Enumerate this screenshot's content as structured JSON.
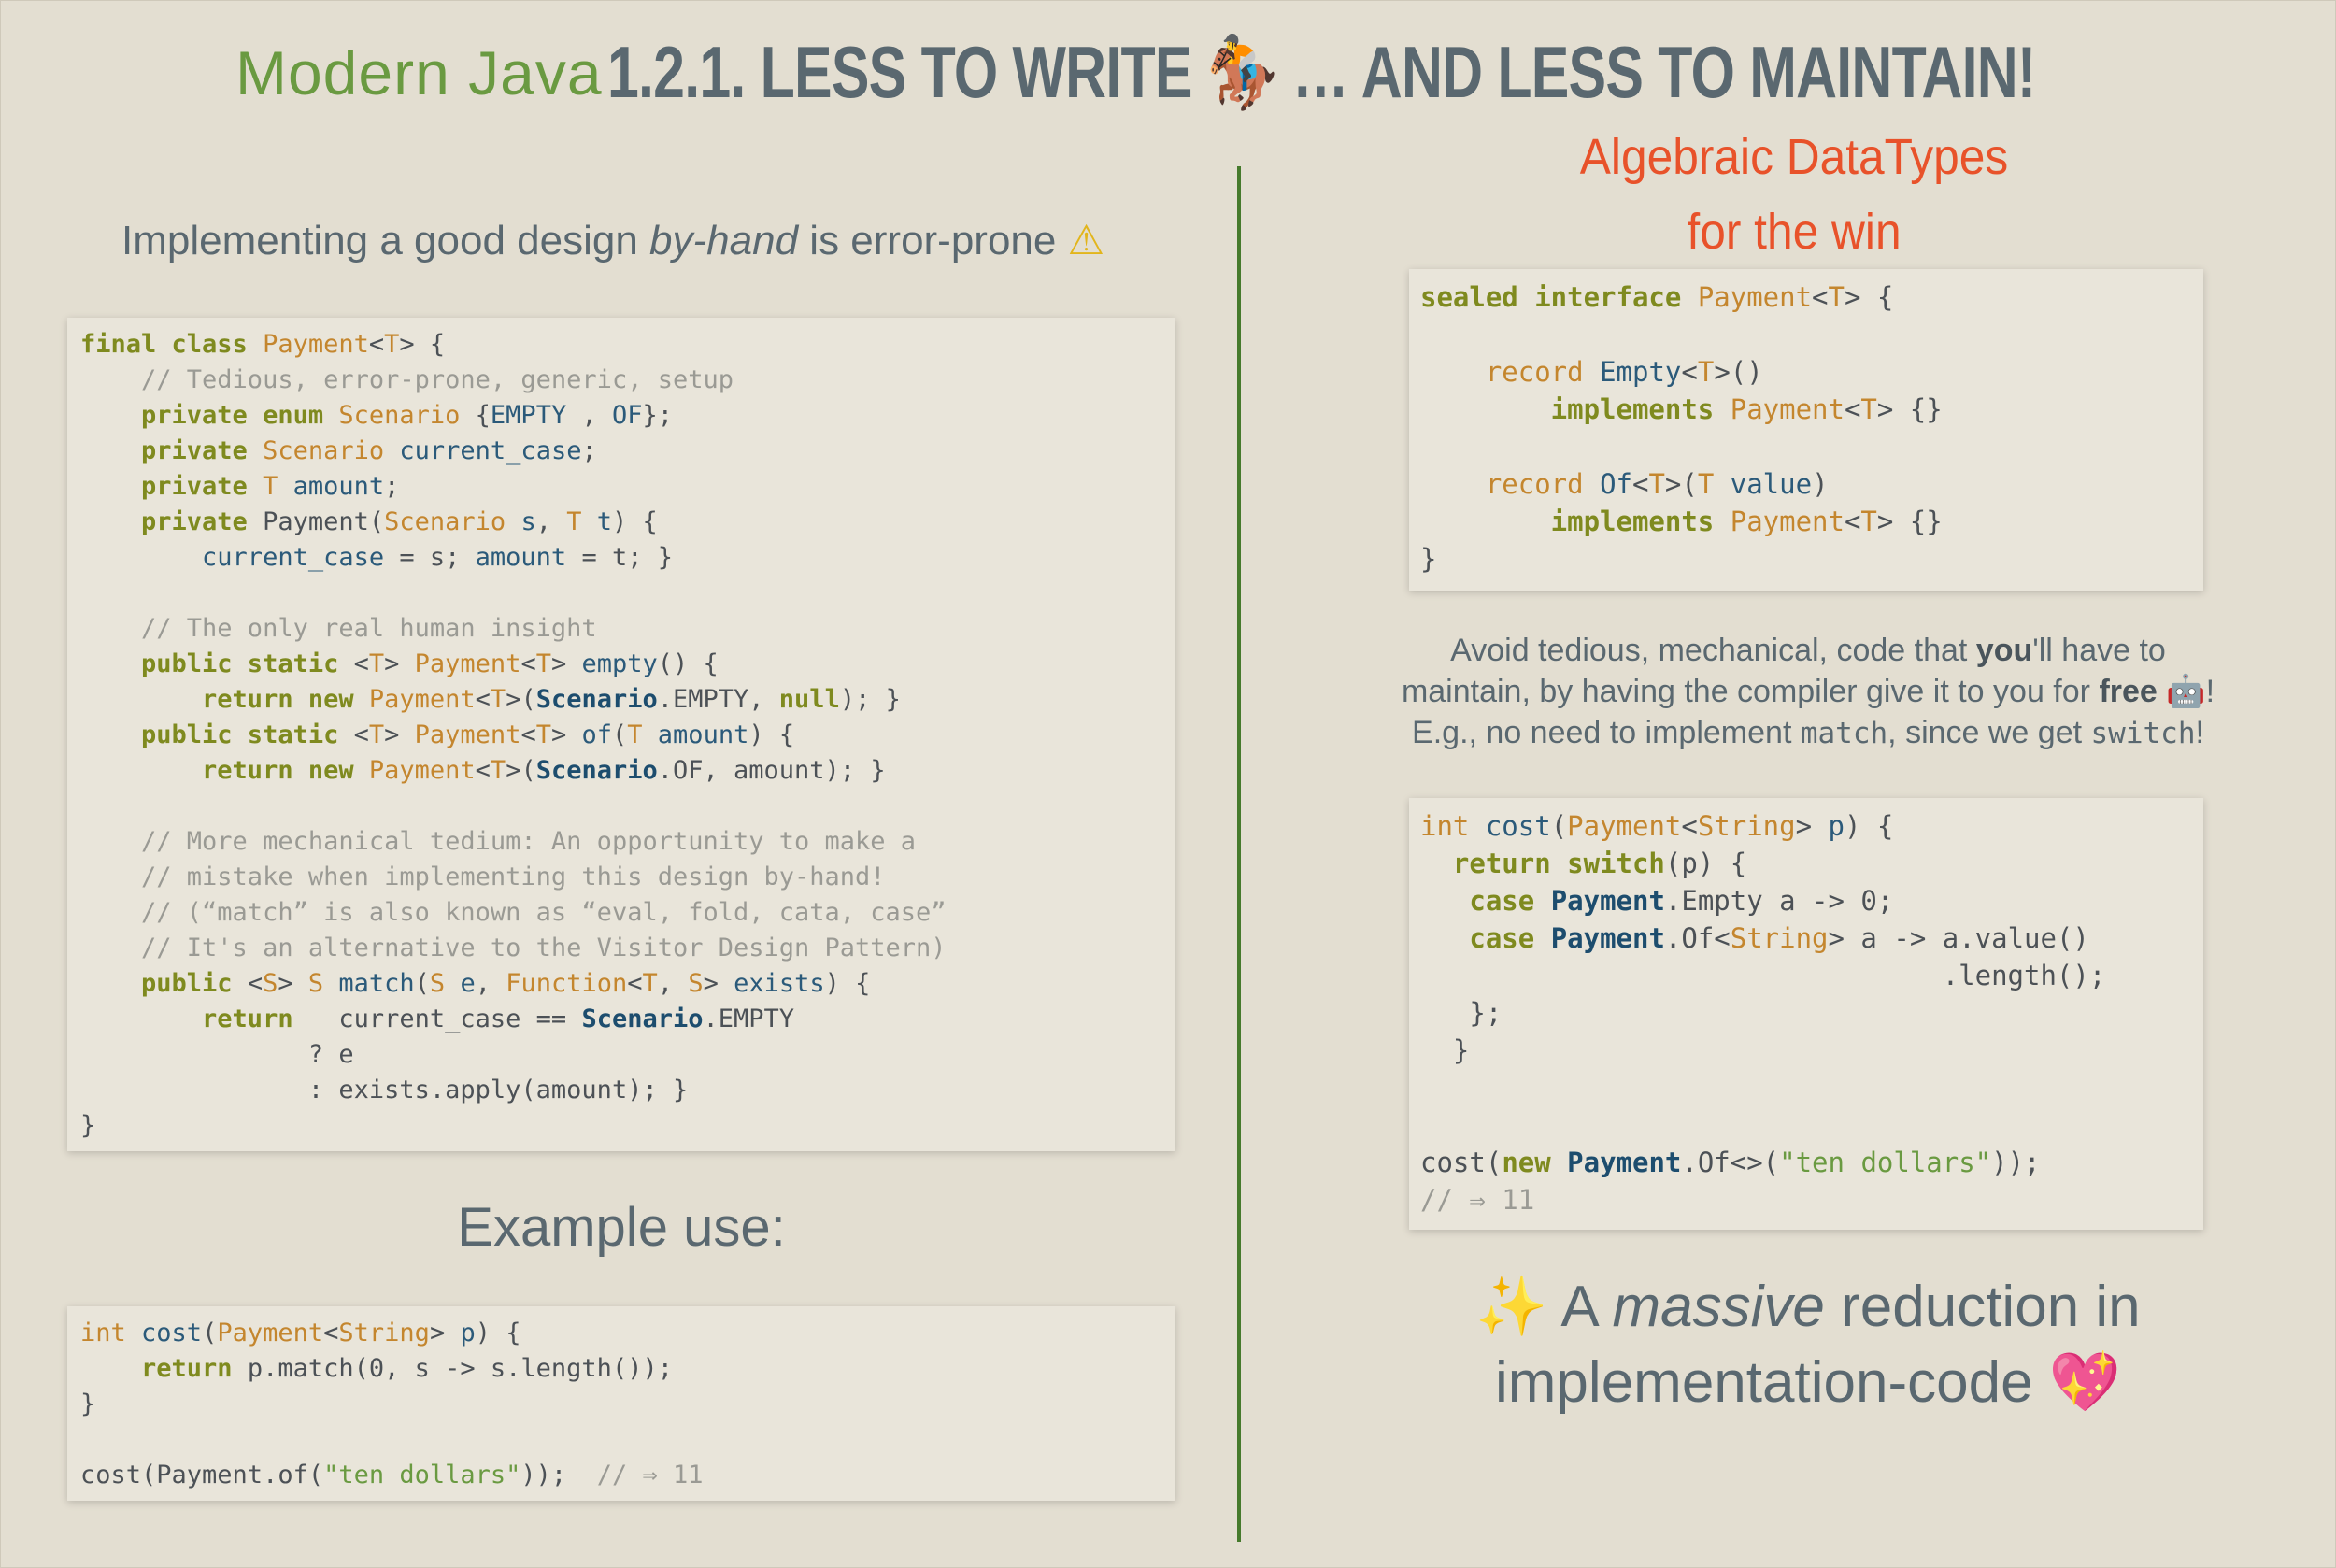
{
  "header": {
    "brand": "Modern Java",
    "title_text": "1.2.1. LESS TO WRITE",
    "title_emoji": "🏇",
    "title_tail": " … AND LESS TO MAINTAIN!",
    "adt_line1": "Algebraic DataTypes",
    "adt_line2": "for the win"
  },
  "left": {
    "lead_pre": "Implementing a good design ",
    "lead_em": "by-hand",
    "lead_post": " is error-prone ",
    "lead_icon": "⚠",
    "example_heading": "Example use:"
  },
  "right": {
    "avoid_1": "Avoid tedious, mechanical, code that ",
    "avoid_you": "you",
    "avoid_2": "'ll have to",
    "avoid_3": "maintain, by having the compiler give it to you for ",
    "avoid_free": "free",
    "avoid_robot": "🤖",
    "avoid_bang": "!",
    "avoid_4": "E.g., no need to implement ",
    "avoid_match": "match",
    "avoid_5": ", since we get ",
    "avoid_switch": "switch",
    "avoid_6": "!",
    "red_spark": "✨",
    "red_1": " A ",
    "red_em": "massive",
    "red_2": " reduction in",
    "red_3": "implementation-code ",
    "red_heart": "💖"
  },
  "code1": [
    [
      [
        "k",
        "final class "
      ],
      [
        "t",
        "Payment"
      ],
      [
        "",
        "<"
      ],
      [
        "t",
        "T"
      ],
      [
        "",
        "> {"
      ]
    ],
    [
      [
        "c",
        "    // Tedious, error-prone, generic, setup"
      ]
    ],
    [
      [
        "k",
        "    private enum "
      ],
      [
        "t",
        "Scenario "
      ],
      [
        "",
        "{"
      ],
      [
        "f",
        "EMPTY"
      ],
      [
        "",
        " , "
      ],
      [
        "f",
        "OF"
      ],
      [
        "",
        "};"
      ]
    ],
    [
      [
        "k",
        "    private "
      ],
      [
        "t",
        "Scenario "
      ],
      [
        "f",
        "current_case"
      ],
      [
        "",
        ";"
      ]
    ],
    [
      [
        "k",
        "    private "
      ],
      [
        "t",
        "T "
      ],
      [
        "f",
        "amount"
      ],
      [
        "",
        ";"
      ]
    ],
    [
      [
        "k",
        "    private "
      ],
      [
        "",
        "Payment("
      ],
      [
        "t",
        "Scenario "
      ],
      [
        "f",
        "s"
      ],
      [
        "",
        ", "
      ],
      [
        "t",
        "T "
      ],
      [
        "f",
        "t"
      ],
      [
        "",
        ") {"
      ]
    ],
    [
      [
        "f",
        "        current_case"
      ],
      [
        "",
        " = s; "
      ],
      [
        "f",
        "amount"
      ],
      [
        "",
        " = t; }"
      ]
    ],
    [
      [
        "",
        ""
      ]
    ],
    [
      [
        "c",
        "    // The only real human insight"
      ]
    ],
    [
      [
        "k",
        "    public static "
      ],
      [
        "",
        "<"
      ],
      [
        "t",
        "T"
      ],
      [
        "",
        "> "
      ],
      [
        "t",
        "Payment"
      ],
      [
        "",
        "<"
      ],
      [
        "t",
        "T"
      ],
      [
        "",
        "> "
      ],
      [
        "f",
        "empty"
      ],
      [
        "",
        "() {"
      ]
    ],
    [
      [
        "k",
        "        return new "
      ],
      [
        "t",
        "Payment"
      ],
      [
        "",
        "<"
      ],
      [
        "t",
        "T"
      ],
      [
        "",
        ">("
      ],
      [
        "b",
        "Scenario"
      ],
      [
        "",
        ".EMPTY, "
      ],
      [
        "k",
        "null"
      ],
      [
        "",
        "); }"
      ]
    ],
    [
      [
        "k",
        "    public static "
      ],
      [
        "",
        "<"
      ],
      [
        "t",
        "T"
      ],
      [
        "",
        "> "
      ],
      [
        "t",
        "Payment"
      ],
      [
        "",
        "<"
      ],
      [
        "t",
        "T"
      ],
      [
        "",
        "> "
      ],
      [
        "f",
        "of"
      ],
      [
        "",
        "("
      ],
      [
        "t",
        "T "
      ],
      [
        "f",
        "amount"
      ],
      [
        "",
        ") {"
      ]
    ],
    [
      [
        "k",
        "        return new "
      ],
      [
        "t",
        "Payment"
      ],
      [
        "",
        "<"
      ],
      [
        "t",
        "T"
      ],
      [
        "",
        ">("
      ],
      [
        "b",
        "Scenario"
      ],
      [
        "",
        ".OF, amount); }"
      ]
    ],
    [
      [
        "",
        ""
      ]
    ],
    [
      [
        "c",
        "    // More mechanical tedium: An opportunity to make a"
      ]
    ],
    [
      [
        "c",
        "    // mistake when implementing this design by-hand!"
      ]
    ],
    [
      [
        "c",
        "    // (“match” is also known as “eval, fold, cata, case”"
      ]
    ],
    [
      [
        "c",
        "    // It's an alternative to the Visitor Design Pattern)"
      ]
    ],
    [
      [
        "k",
        "    public "
      ],
      [
        "",
        "<"
      ],
      [
        "t",
        "S"
      ],
      [
        "",
        "> "
      ],
      [
        "t",
        "S "
      ],
      [
        "f",
        "match"
      ],
      [
        "",
        "("
      ],
      [
        "t",
        "S "
      ],
      [
        "f",
        "e"
      ],
      [
        "",
        ", "
      ],
      [
        "t",
        "Function"
      ],
      [
        "",
        "<"
      ],
      [
        "t",
        "T"
      ],
      [
        "",
        ", "
      ],
      [
        "t",
        "S"
      ],
      [
        "",
        "> "
      ],
      [
        "f",
        "exists"
      ],
      [
        "",
        ") {"
      ]
    ],
    [
      [
        "k",
        "        return   "
      ],
      [
        "",
        "current_case == "
      ],
      [
        "b",
        "Scenario"
      ],
      [
        "",
        ".EMPTY"
      ]
    ],
    [
      [
        "",
        "               ? e"
      ]
    ],
    [
      [
        "",
        "               : exists.apply(amount); }"
      ]
    ],
    [
      [
        "",
        "}"
      ]
    ]
  ],
  "code2": [
    [
      [
        "t",
        "int "
      ],
      [
        "f",
        "cost"
      ],
      [
        "",
        "("
      ],
      [
        "t",
        "Payment"
      ],
      [
        "",
        "<"
      ],
      [
        "t",
        "String"
      ],
      [
        "",
        "> "
      ],
      [
        "f",
        "p"
      ],
      [
        "",
        ") {"
      ]
    ],
    [
      [
        "k",
        "    return "
      ],
      [
        "",
        "p.match(0, s -> s.length());"
      ]
    ],
    [
      [
        "",
        "}"
      ]
    ],
    [
      [
        "",
        ""
      ]
    ],
    [
      [
        "",
        "cost(Payment.of("
      ],
      [
        "s",
        "\"ten dollars\""
      ],
      [
        "",
        "));  "
      ],
      [
        "c",
        "// ⇒ 11"
      ]
    ]
  ],
  "code3": [
    [
      [
        "k",
        "sealed interface "
      ],
      [
        "t",
        "Payment"
      ],
      [
        "",
        "<"
      ],
      [
        "t",
        "T"
      ],
      [
        "",
        "> {"
      ]
    ],
    [
      [
        "",
        ""
      ]
    ],
    [
      [
        "t",
        "    record "
      ],
      [
        "f",
        "Empty"
      ],
      [
        "",
        "<"
      ],
      [
        "t",
        "T"
      ],
      [
        "",
        ">()"
      ]
    ],
    [
      [
        "k",
        "        implements "
      ],
      [
        "t",
        "Payment"
      ],
      [
        "",
        "<"
      ],
      [
        "t",
        "T"
      ],
      [
        "",
        "> {}"
      ]
    ],
    [
      [
        "",
        ""
      ]
    ],
    [
      [
        "t",
        "    record "
      ],
      [
        "f",
        "Of"
      ],
      [
        "",
        "<"
      ],
      [
        "t",
        "T"
      ],
      [
        "",
        ">("
      ],
      [
        "t",
        "T "
      ],
      [
        "f",
        "value"
      ],
      [
        "",
        ")"
      ]
    ],
    [
      [
        "k",
        "        implements "
      ],
      [
        "t",
        "Payment"
      ],
      [
        "",
        "<"
      ],
      [
        "t",
        "T"
      ],
      [
        "",
        "> {}"
      ]
    ],
    [
      [
        "",
        "}"
      ]
    ]
  ],
  "code4": [
    [
      [
        "t",
        "int "
      ],
      [
        "f",
        "cost"
      ],
      [
        "",
        "("
      ],
      [
        "t",
        "Payment"
      ],
      [
        "",
        "<"
      ],
      [
        "t",
        "String"
      ],
      [
        "",
        "> "
      ],
      [
        "f",
        "p"
      ],
      [
        "",
        ") {"
      ]
    ],
    [
      [
        "k",
        "  return switch"
      ],
      [
        "",
        "(p) {"
      ]
    ],
    [
      [
        "k",
        "   case "
      ],
      [
        "b",
        "Payment"
      ],
      [
        "",
        ".Empty a -> 0;"
      ]
    ],
    [
      [
        "k",
        "   case "
      ],
      [
        "b",
        "Payment"
      ],
      [
        "",
        ".Of<"
      ],
      [
        "t",
        "String"
      ],
      [
        "",
        "> a -> a.value()"
      ]
    ],
    [
      [
        "",
        "                                .length();"
      ]
    ],
    [
      [
        "",
        "   };"
      ]
    ],
    [
      [
        "",
        "  }"
      ]
    ],
    [
      [
        "",
        ""
      ]
    ],
    [
      [
        "",
        ""
      ]
    ],
    [
      [
        "",
        "cost("
      ],
      [
        "k",
        "new "
      ],
      [
        "b",
        "Payment"
      ],
      [
        "",
        ".Of<>("
      ],
      [
        "s",
        "\"ten dollars\""
      ],
      [
        "",
        "));"
      ]
    ],
    [
      [
        "c",
        "// ⇒ 11"
      ]
    ]
  ]
}
